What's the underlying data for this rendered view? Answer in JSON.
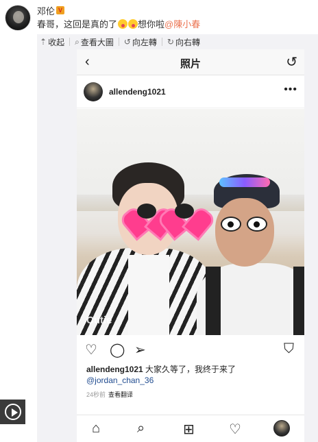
{
  "post": {
    "author": "邓伦",
    "badge": "V",
    "text_before": "春哥，这回是真的了",
    "text_after": "想你啦",
    "mention": "@陳小春",
    "emoji": [
      "surprised-face-emoji",
      "surprised-face-emoji"
    ]
  },
  "toolbar": {
    "collapse": "收起",
    "view_large": "查看大圖",
    "rotate_left": "向左轉",
    "rotate_right": "向右轉"
  },
  "instagram": {
    "header_title": "照片",
    "username": "allendeng1021",
    "more": "•••",
    "watermark": "Cutie",
    "caption_user": "allendeng1021",
    "caption_text": " 大家久等了，我终于来了",
    "caption_tag": "@jordan_chan_36",
    "time": "24秒前",
    "translate": "查看翻译"
  },
  "colors": {
    "mention": "#eb7350",
    "panel_bg": "#f2f2f5",
    "tag": "#1f4b8f"
  }
}
